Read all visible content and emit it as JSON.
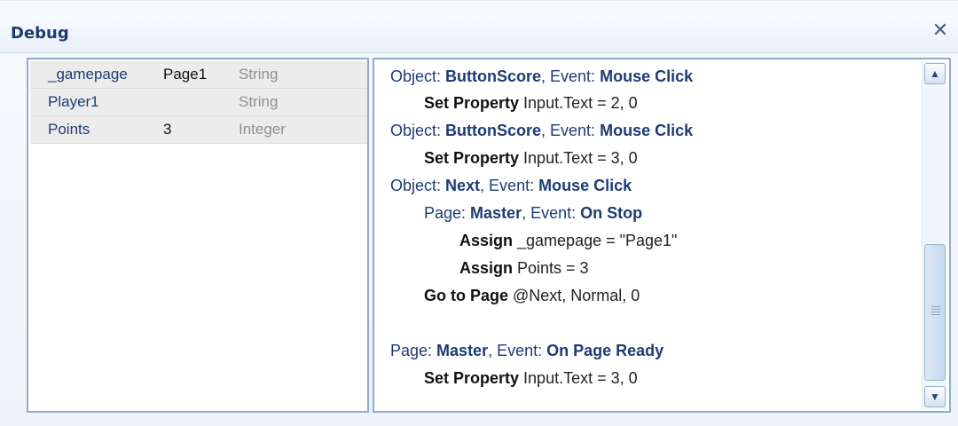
{
  "window": {
    "title": "Debug",
    "close_glyph": "✕"
  },
  "variables": [
    {
      "name": "_gamepage",
      "value": "Page1",
      "type": "String"
    },
    {
      "name": "Player1",
      "value": "",
      "type": "String"
    },
    {
      "name": "Points",
      "value": "3",
      "type": "Integer"
    }
  ],
  "log": [
    {
      "parts": [
        "Object: ",
        "ButtonScore",
        ", Event: ",
        "Mouse Click"
      ]
    },
    {
      "parts": [
        "Set Property",
        " Input.Text = 2, 0"
      ]
    },
    {
      "parts": [
        "Object: ",
        "ButtonScore",
        ", Event: ",
        "Mouse Click"
      ]
    },
    {
      "parts": [
        "Set Property",
        " Input.Text = 3, 0"
      ]
    },
    {
      "parts": [
        "Object: ",
        "Next",
        ", Event: ",
        "Mouse Click"
      ]
    },
    {
      "parts": [
        "Page: ",
        "Master",
        ", Event: ",
        "On Stop"
      ]
    },
    {
      "parts": [
        "Assign",
        " _gamepage = \"Page1\""
      ]
    },
    {
      "parts": [
        "Assign",
        " Points = 3"
      ]
    },
    {
      "parts": [
        "Go to Page",
        " @Next, Normal, 0"
      ]
    },
    {
      "parts": [
        "Page: ",
        "Master",
        ", Event: ",
        "On Page Ready"
      ]
    },
    {
      "parts": [
        "Set Property",
        " Input.Text = 3, 0"
      ]
    }
  ],
  "scrollbar": {
    "up_glyph": "▲",
    "down_glyph": "▼"
  },
  "colors": {
    "title": "#1e3a73",
    "keyword": "#1d3b75",
    "panel_border": "#8facc9"
  }
}
